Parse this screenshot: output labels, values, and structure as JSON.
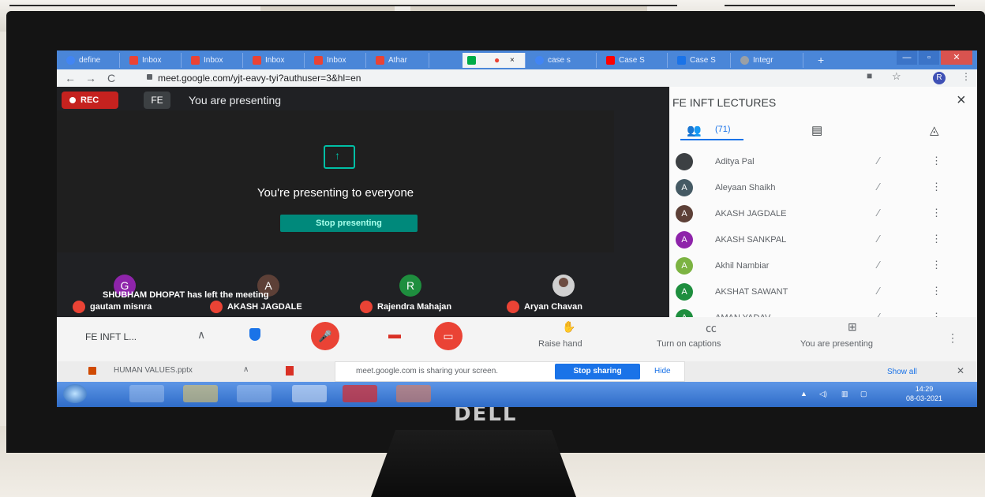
{
  "browser": {
    "tabs": [
      {
        "label": "define",
        "icon": "google-icon",
        "color": "#4285f4"
      },
      {
        "label": "Inbox",
        "icon": "gmail-icon",
        "color": "#ea4335"
      },
      {
        "label": "Inbox",
        "icon": "gmail-icon",
        "color": "#ea4335"
      },
      {
        "label": "Inbox",
        "icon": "gmail-icon",
        "color": "#ea4335"
      },
      {
        "label": "Inbox",
        "icon": "gmail-icon",
        "color": "#ea4335"
      },
      {
        "label": "Athar",
        "icon": "gmail-icon",
        "color": "#ea4335"
      },
      {
        "label": "",
        "icon": "meet-icon",
        "color": "#00ac47"
      },
      {
        "label": "case s",
        "icon": "google-icon",
        "color": "#4285f4"
      },
      {
        "label": "Case S",
        "icon": "youtube-icon",
        "color": "#ff0000"
      },
      {
        "label": "Case S",
        "icon": "docs-icon",
        "color": "#1a73e8"
      },
      {
        "label": "Integr",
        "icon": "web-icon",
        "color": "#9aa0a6"
      }
    ],
    "new_tab": "+",
    "close_tab": "×",
    "url": "meet.google.com/yjt-eavy-tyi?authuser=3&hl=en",
    "profile_initial": "R"
  },
  "meet": {
    "rec_label": "REC",
    "presenter_chip": "FE",
    "presenting_title": "You are presenting",
    "presenting_message": "You're presenting to everyone",
    "stop_presenting": "Stop presenting",
    "notification": "SHUBHAM DHOPAT has left the meeting",
    "tiles": [
      {
        "name": "gautam misnra",
        "initial": "G",
        "color": "#8e24aa"
      },
      {
        "name": "AKASH JAGDALE",
        "initial": "A",
        "color": "#5d4037"
      },
      {
        "name": "Rajendra Mahajan",
        "initial": "R",
        "color": "#1e8e3e"
      },
      {
        "name": "Aryan Chavan",
        "initial": "",
        "color": "#d0d0d0"
      }
    ]
  },
  "panel": {
    "title": "FE INFT LECTURES",
    "close": "×",
    "people_count": "(71)",
    "participants": [
      {
        "name": "Aditya Pal",
        "initial": "",
        "color": "#3c4043"
      },
      {
        "name": "Aleyaan Shaikh",
        "initial": "A",
        "color": "#455a64"
      },
      {
        "name": "AKASH JAGDALE",
        "initial": "A",
        "color": "#5d4037"
      },
      {
        "name": "AKASH SANKPAL",
        "initial": "A",
        "color": "#8e24aa"
      },
      {
        "name": "Akhil Nambiar",
        "initial": "A",
        "color": "#7cb342"
      },
      {
        "name": "AKSHAT SAWANT",
        "initial": "A",
        "color": "#1e8e3e"
      },
      {
        "name": "AMAN YADAV",
        "initial": "A",
        "color": "#1e8e3e"
      }
    ]
  },
  "controls": {
    "meeting_name": "FE INFT L...",
    "raise_hand": "Raise hand",
    "captions": "Turn on captions",
    "presenting": "You are presenting",
    "mic_icon": "mic-off-icon",
    "cam_icon": "camera-off-icon"
  },
  "downloads": {
    "file": "HUMAN VALUES.pptx",
    "share_message": "meet.google.com is sharing your screen.",
    "stop_sharing": "Stop sharing",
    "hide": "Hide",
    "show_all": "Show all"
  },
  "taskbar": {
    "time": "14:29",
    "date": "08-03-2021"
  },
  "monitor": {
    "brand": "DELL"
  }
}
